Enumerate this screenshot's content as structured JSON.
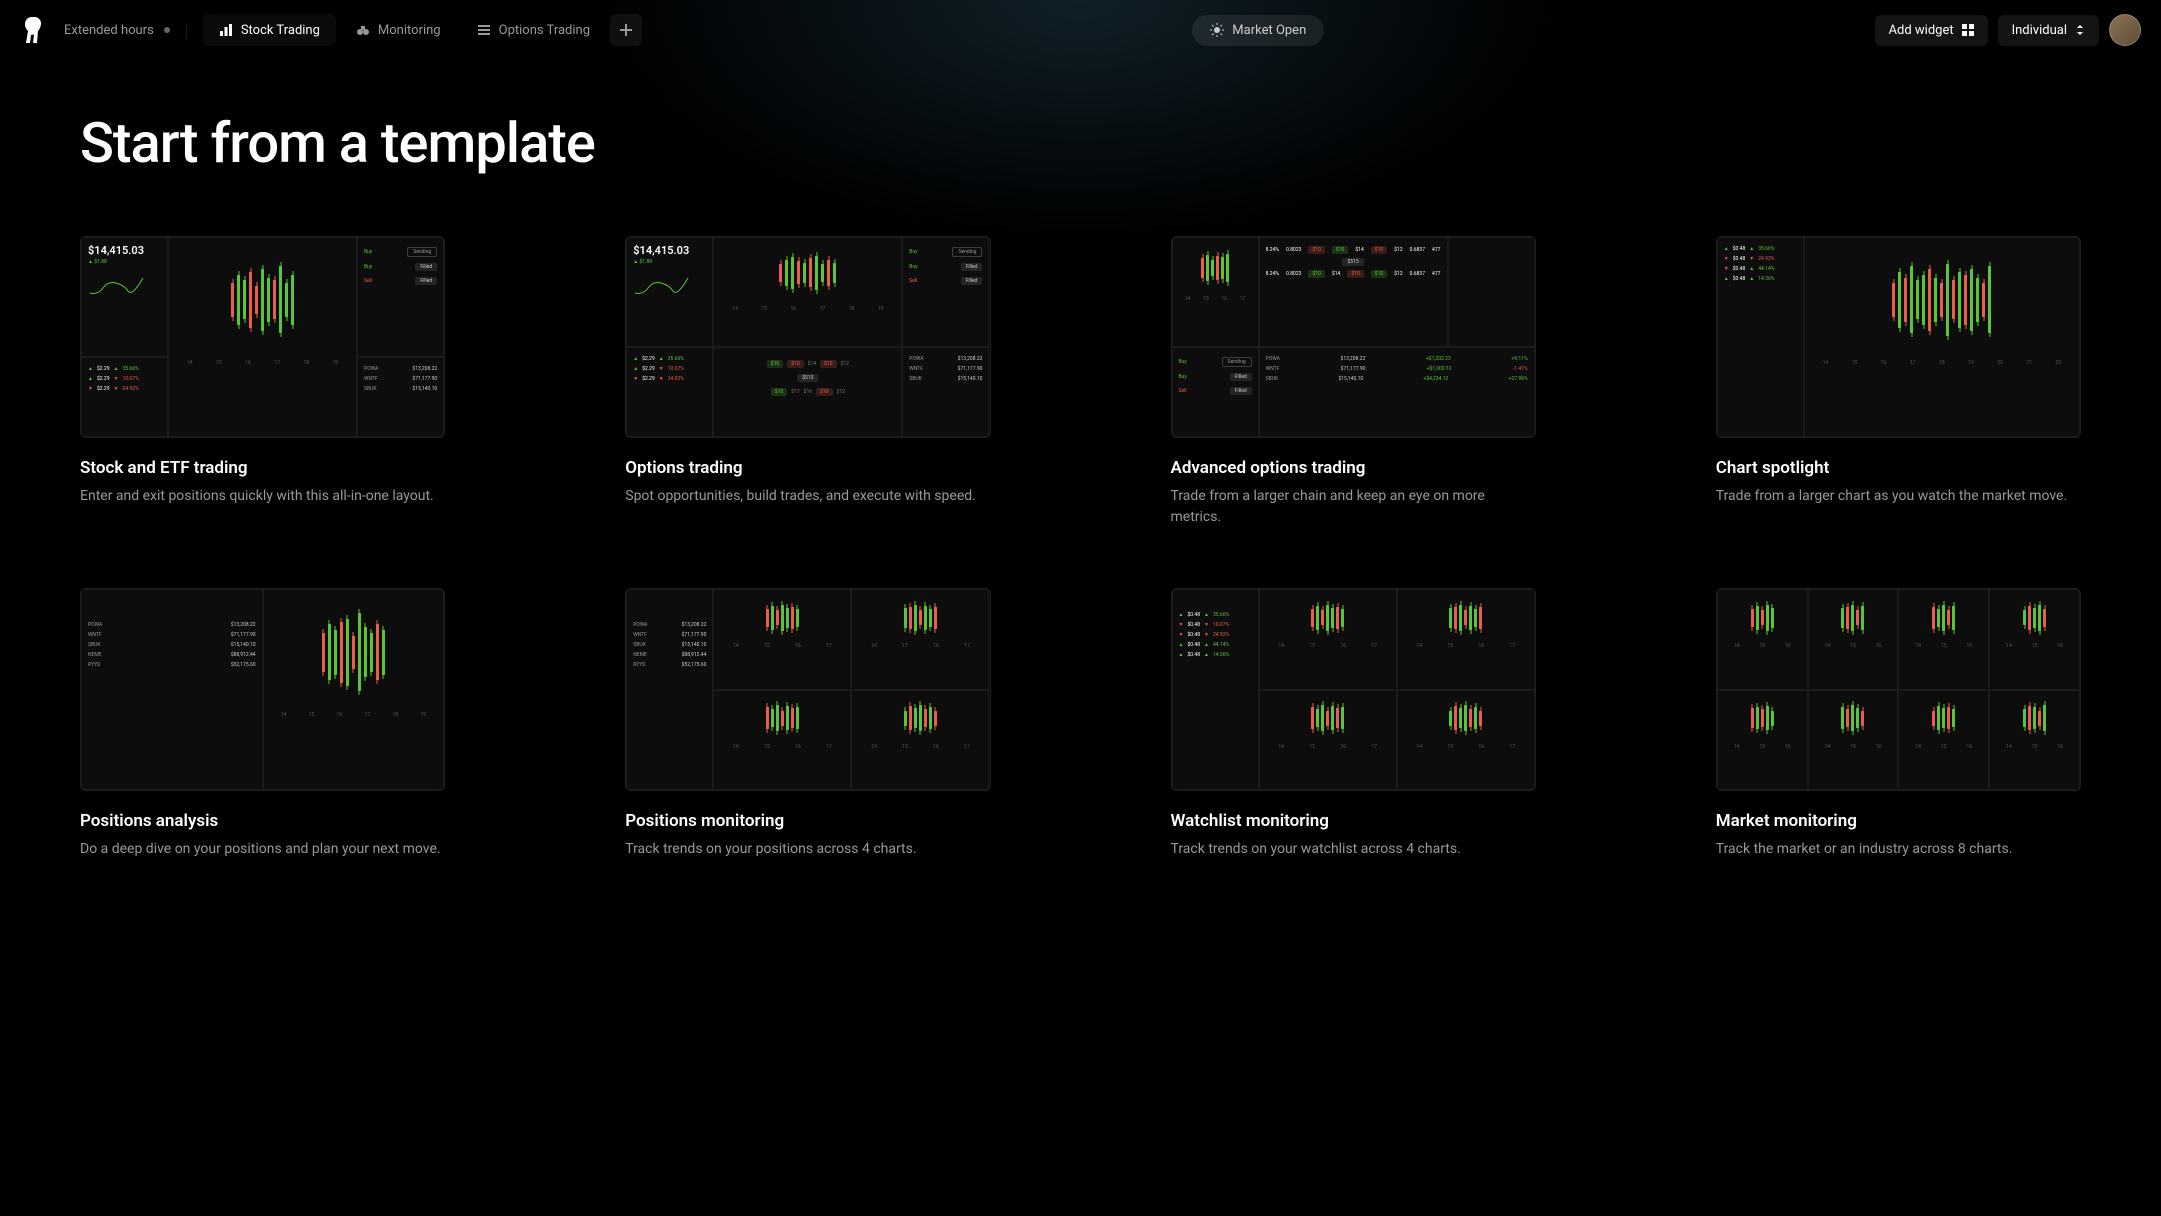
{
  "header": {
    "extended_hours_label": "Extended hours",
    "tabs": [
      {
        "label": "Stock Trading",
        "icon": "bar-chart",
        "active": true
      },
      {
        "label": "Monitoring",
        "icon": "binoculars",
        "active": false
      },
      {
        "label": "Options Trading",
        "icon": "list",
        "active": false
      }
    ],
    "market_status": "Market Open",
    "add_widget_label": "Add widget",
    "account_label": "Individual"
  },
  "page": {
    "title": "Start from a template"
  },
  "templates": [
    {
      "title": "Stock and ETF trading",
      "desc": "Enter and exit positions quickly with this all-in-one layout.",
      "layout": "stock-etf"
    },
    {
      "title": "Options trading",
      "desc": "Spot opportunities, build trades, and execute with speed.",
      "layout": "options"
    },
    {
      "title": "Advanced options trading",
      "desc": "Trade from a larger chain and keep an eye on more metrics.",
      "layout": "advanced"
    },
    {
      "title": "Chart spotlight",
      "desc": "Trade from a larger chart as you watch the market move.",
      "layout": "chart"
    },
    {
      "title": "Positions analysis",
      "desc": "Do a deep dive on your positions and plan your next move.",
      "layout": "positions"
    },
    {
      "title": "Positions monitoring",
      "desc": "Track trends on your positions across 4 charts.",
      "layout": "4charts"
    },
    {
      "title": "Watchlist monitoring",
      "desc": "Track trends on your watchlist across 4 charts.",
      "layout": "watchlist"
    },
    {
      "title": "Market monitoring",
      "desc": "Track the market or an industry across 8 charts.",
      "layout": "8charts"
    }
  ],
  "preview": {
    "main_price": "$14,415.03",
    "main_sub": "$1.88",
    "axis_times": [
      "14",
      "15",
      "16",
      "17",
      "18",
      "19"
    ],
    "axis_times_long": [
      "14",
      "15",
      "16",
      "17",
      "18",
      "19",
      "20",
      "21",
      "22"
    ],
    "axis_times_short": [
      "14",
      "15",
      "16",
      "17"
    ],
    "stat_rows": [
      {
        "dir": "up",
        "val": "$2.29",
        "pdir": "up",
        "pct": "35.66%"
      },
      {
        "dir": "up",
        "val": "$2.29",
        "pdir": "down",
        "pct": "10.07%"
      },
      {
        "dir": "down",
        "val": "$2.29",
        "pdir": "down",
        "pct": "24.92%"
      }
    ],
    "chart_stats": [
      {
        "dir": "up",
        "val": "$0.48",
        "pdir": "up",
        "pct": "35.66%"
      },
      {
        "dir": "down",
        "val": "$0.48",
        "pdir": "down",
        "pct": "24.92%"
      },
      {
        "dir": "down",
        "val": "$0.48",
        "pdir": "up",
        "pct": "44.14%"
      },
      {
        "dir": "up",
        "val": "$0.48",
        "pdir": "up",
        "pct": "14.36%"
      }
    ],
    "watchlist_stats": [
      {
        "dir": "up",
        "val": "$0.48",
        "pdir": "up",
        "pct": "35.66%"
      },
      {
        "dir": "down",
        "val": "$0.48",
        "pdir": "down",
        "pct": "10.07%"
      },
      {
        "dir": "down",
        "val": "$0.48",
        "pdir": "down",
        "pct": "24.92%"
      },
      {
        "dir": "up",
        "val": "$0.48",
        "pdir": "up",
        "pct": "44.14%"
      },
      {
        "dir": "up",
        "val": "$0.48",
        "pdir": "up",
        "pct": "14.36%"
      }
    ],
    "positions_small": [
      {
        "sym": "POWA",
        "val": "$13,208.22"
      },
      {
        "sym": "WNTF",
        "val": "$71,177.90"
      },
      {
        "sym": "SBUK",
        "val": "$15,140.10"
      }
    ],
    "positions_large": [
      {
        "sym": "POWA",
        "val": "$13,208.22"
      },
      {
        "sym": "WNTF",
        "val": "$71,177.90"
      },
      {
        "sym": "SBUK",
        "val": "$15,140.10"
      },
      {
        "sym": "NEME",
        "val": "$88,912.44"
      },
      {
        "sym": "RYYD",
        "val": "$52,175.60"
      }
    ],
    "orders": [
      {
        "side": "Buy",
        "status": "Sending"
      },
      {
        "side": "Buy",
        "status": "Filled"
      },
      {
        "side": "Sell",
        "status": "Filled"
      }
    ],
    "chain_row": {
      "a": "8.24%",
      "b": "0.8023",
      "p1": "$10",
      "p2": "$10",
      "c": "$14",
      "p3": "$10",
      "d": "$12",
      "e": "0.6837",
      "f": "477"
    },
    "chain_mid": "$515",
    "strike_row": [
      "$10",
      "$10",
      "$14",
      "$10",
      "$12"
    ],
    "strike_row2": [
      "$10",
      "$17",
      "$16",
      "$10",
      "$12"
    ],
    "strike_mid": "$515",
    "adv_orders": [
      {
        "side": "Buy",
        "status": "Sending"
      },
      {
        "side": "Buy",
        "status": "Filled"
      },
      {
        "side": "Sell",
        "status": "Filled"
      }
    ],
    "adv_positions": [
      {
        "sym": "POWA",
        "val": "$13,208.22",
        "ch": "+$1,202.23",
        "pct": "+9.11%",
        "cls": "g"
      },
      {
        "sym": "WNTF",
        "val": "$71,177.90",
        "ch": "+$1,000.12",
        "pct": "-1.41%",
        "cls": "r"
      },
      {
        "sym": "SBUK",
        "val": "$15,140.10",
        "ch": "+$4,234.12",
        "pct": "+27.96%",
        "cls": "g"
      }
    ]
  }
}
